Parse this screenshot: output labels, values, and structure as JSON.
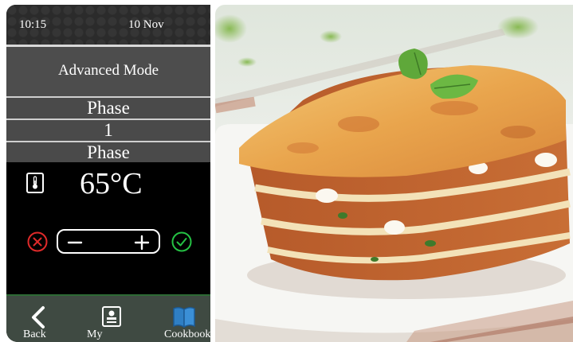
{
  "status": {
    "time": "10:15",
    "date": "10 Nov"
  },
  "mode": {
    "title": "Advanced Mode"
  },
  "phase": {
    "label_top": "Phase",
    "number": "1",
    "label_bottom": "Phase"
  },
  "temperature": {
    "value": "65°C",
    "icon": "thermometer-icon"
  },
  "controls": {
    "cancel_icon": "cancel-icon",
    "confirm_icon": "confirm-icon",
    "minus_icon": "minus-icon",
    "plus_icon": "plus-icon"
  },
  "nav": {
    "items": [
      {
        "label": "Back",
        "icon": "back-arrow-icon"
      },
      {
        "label": "My",
        "icon": "my-recipes-icon"
      },
      {
        "label": "Cookbook",
        "icon": "cookbook-icon"
      }
    ]
  },
  "photo": {
    "subject": "lasagna",
    "icon": "lasagna-photo"
  },
  "colors": {
    "cancel": "#e02a2a",
    "confirm": "#25c244",
    "cookbook": "#2f7fc4",
    "panel_bg": "#000000",
    "row_bg": "#4a4a4a",
    "nav_bg": "#3f4a42"
  }
}
